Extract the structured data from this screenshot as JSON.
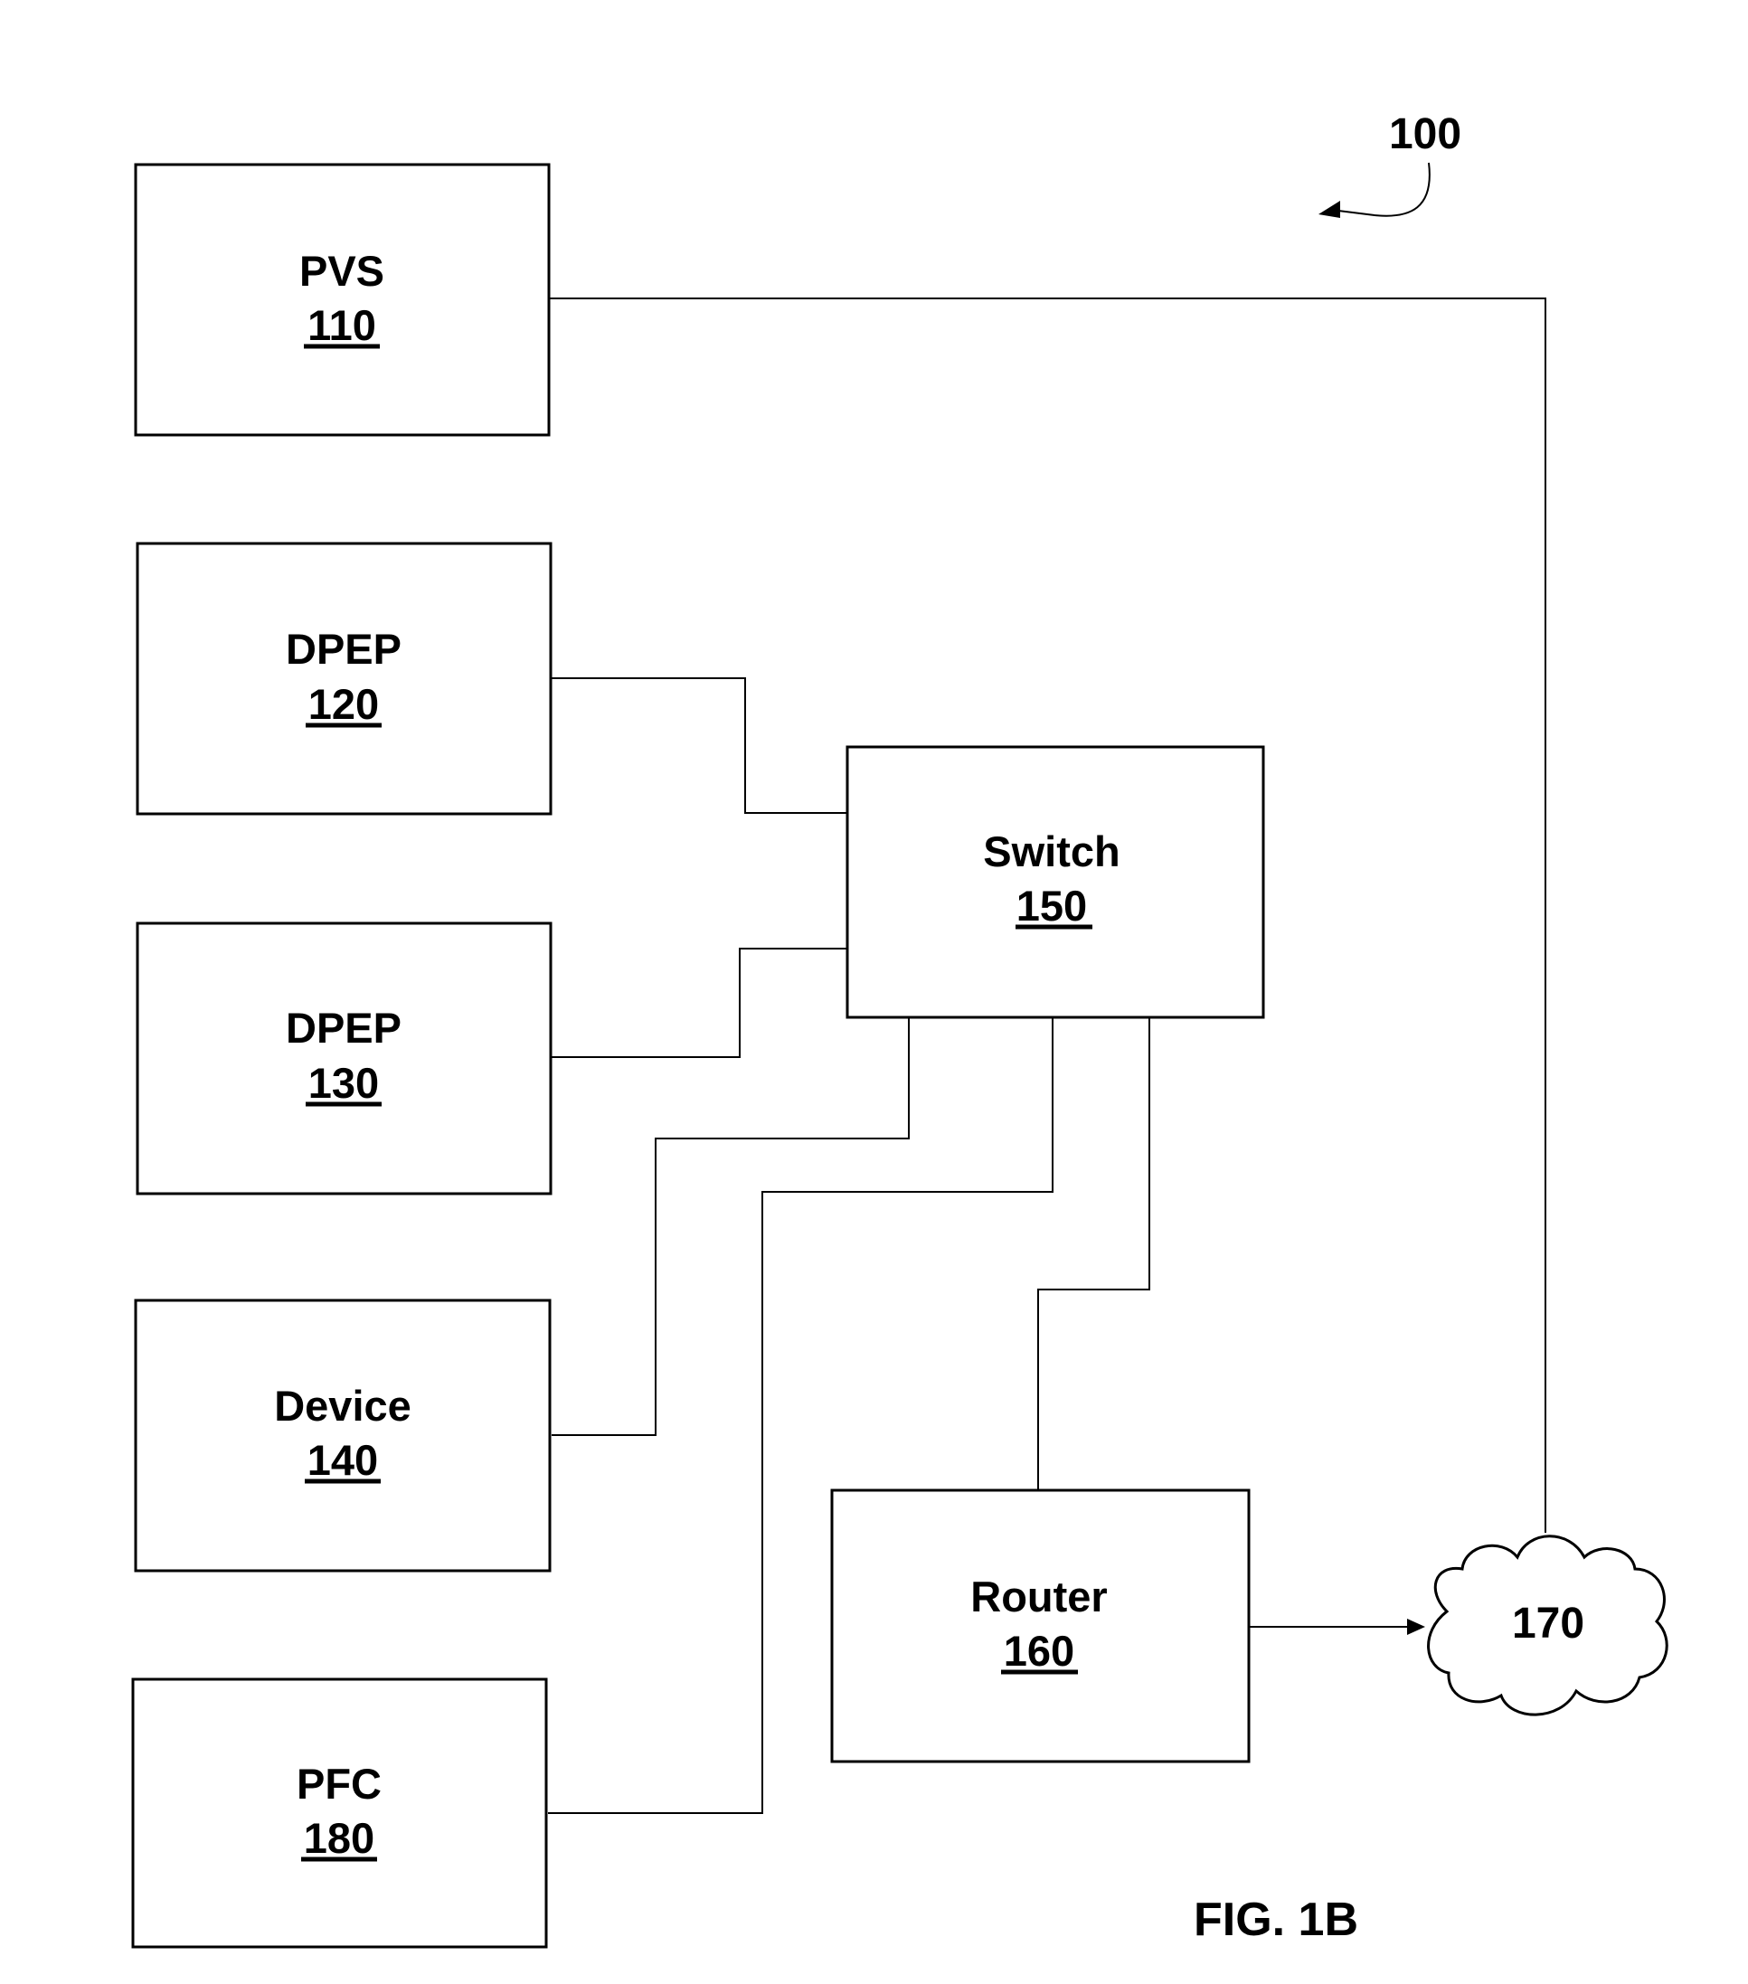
{
  "figure": {
    "label": "FIG. 1B",
    "system_ref": "100"
  },
  "blocks": [
    {
      "id": "pvs",
      "name": "PVS",
      "ref": "110"
    },
    {
      "id": "dpep120",
      "name": "DPEP",
      "ref": "120"
    },
    {
      "id": "dpep130",
      "name": "DPEP",
      "ref": "130"
    },
    {
      "id": "device",
      "name": "Device",
      "ref": "140"
    },
    {
      "id": "pfc",
      "name": "PFC",
      "ref": "180"
    },
    {
      "id": "switch",
      "name": "Switch",
      "ref": "150"
    },
    {
      "id": "router",
      "name": "Router",
      "ref": "160"
    }
  ],
  "network": {
    "ref": "170"
  },
  "connections": [
    {
      "from": "PVS 110",
      "to": "Network 170"
    },
    {
      "from": "DPEP 120",
      "to": "Switch 150"
    },
    {
      "from": "DPEP 130",
      "to": "Switch 150"
    },
    {
      "from": "Device 140",
      "to": "Switch 150"
    },
    {
      "from": "PFC 180",
      "to": "Switch 150"
    },
    {
      "from": "Switch 150",
      "to": "Router 160"
    },
    {
      "from": "Router 160",
      "to": "Network 170",
      "arrow": true
    }
  ],
  "colors": {
    "ink": "#000000",
    "paper": "#ffffff"
  }
}
